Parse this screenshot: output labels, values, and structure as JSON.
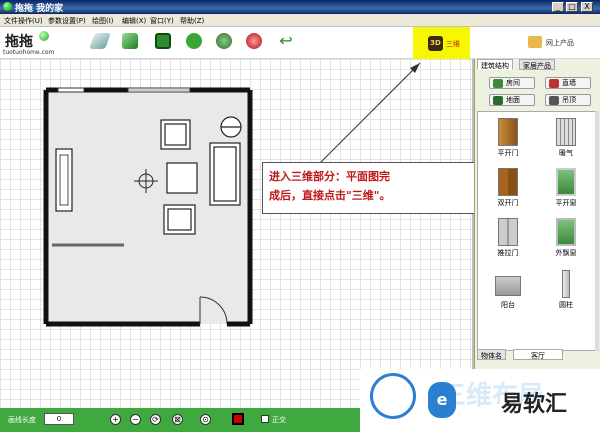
{
  "window": {
    "title": "拖拖 我的家",
    "controls": [
      "_",
      "□",
      "X"
    ]
  },
  "menu": {
    "items": [
      "文件操作(U)",
      "参数设置(P)",
      "绘图(I)",
      "编辑(X)",
      "窗口(Y)",
      "帮助(Z)"
    ]
  },
  "toolbar": {
    "logo_mark": "拖拖",
    "logo_url": "tuotuohome.com",
    "btn_3d_badge": "3D",
    "btn_3d_label": "三维",
    "online_label": "网上产品",
    "icons": [
      "draw-wall-icon",
      "room-icon",
      "save-icon",
      "undo-icon",
      "redo-icon",
      "stop-icon",
      "back-icon"
    ]
  },
  "callout": {
    "line1": "进入三维部分：平面图完",
    "line2": "成后，直接点击\"三维\"。"
  },
  "panel": {
    "tabs": [
      "建筑结构",
      "家居产品"
    ],
    "category_buttons": [
      "房间",
      "直墙",
      "地面",
      "吊顶"
    ],
    "items": [
      "平开门",
      "暖气",
      "双开门",
      "平开窗",
      "推拉门",
      "外飘窗",
      "阳台",
      "圆柱"
    ],
    "bottom_tabs": [
      "物体名",
      "客厅"
    ]
  },
  "statusbar": {
    "wall_length_label": "画线长度",
    "wall_length_value": "0",
    "zoom_buttons": [
      "+",
      "−",
      "⟳",
      "⊠",
      "⊙"
    ],
    "ortho_label": "正交"
  },
  "watermark": {
    "text": "易软汇",
    "faint_text": "三维布局"
  },
  "colors": {
    "title_bar": "#0a246a",
    "status_bar": "#3fa83f",
    "highlight": "#f7f700",
    "callout_text": "#c01818"
  }
}
